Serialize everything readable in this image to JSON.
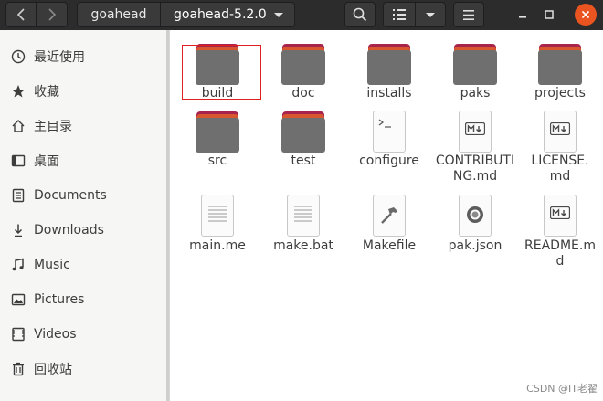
{
  "header": {
    "breadcrumb_home": "goahead",
    "breadcrumb_current": "goahead-5.2.0",
    "colors": {
      "bar": "#2c2c2c",
      "close": "#e95420"
    }
  },
  "sidebar": {
    "items": [
      {
        "label": "最近使用",
        "icon": "clock-icon"
      },
      {
        "label": "收藏",
        "icon": "star-icon"
      },
      {
        "label": "主目录",
        "icon": "home-icon"
      },
      {
        "label": "桌面",
        "icon": "desktop-icon"
      },
      {
        "label": "Documents",
        "icon": "document-icon"
      },
      {
        "label": "Downloads",
        "icon": "download-icon"
      },
      {
        "label": "Music",
        "icon": "music-icon"
      },
      {
        "label": "Pictures",
        "icon": "picture-icon"
      },
      {
        "label": "Videos",
        "icon": "video-icon"
      },
      {
        "label": "回收站",
        "icon": "trash-icon"
      }
    ]
  },
  "files": [
    {
      "name": "build",
      "type": "folder",
      "selected": true
    },
    {
      "name": "doc",
      "type": "folder"
    },
    {
      "name": "installs",
      "type": "folder"
    },
    {
      "name": "paks",
      "type": "folder"
    },
    {
      "name": "projects",
      "type": "folder"
    },
    {
      "name": "src",
      "type": "folder"
    },
    {
      "name": "test",
      "type": "folder"
    },
    {
      "name": "configure",
      "type": "script"
    },
    {
      "name": "CONTRIBUTING.md",
      "type": "markdown"
    },
    {
      "name": "LICENSE.md",
      "type": "markdown"
    },
    {
      "name": "main.me",
      "type": "text"
    },
    {
      "name": "make.bat",
      "type": "text"
    },
    {
      "name": "Makefile",
      "type": "makefile"
    },
    {
      "name": "pak.json",
      "type": "json"
    },
    {
      "name": "README.md",
      "type": "markdown"
    }
  ],
  "watermark": "CSDN @IT老翟"
}
